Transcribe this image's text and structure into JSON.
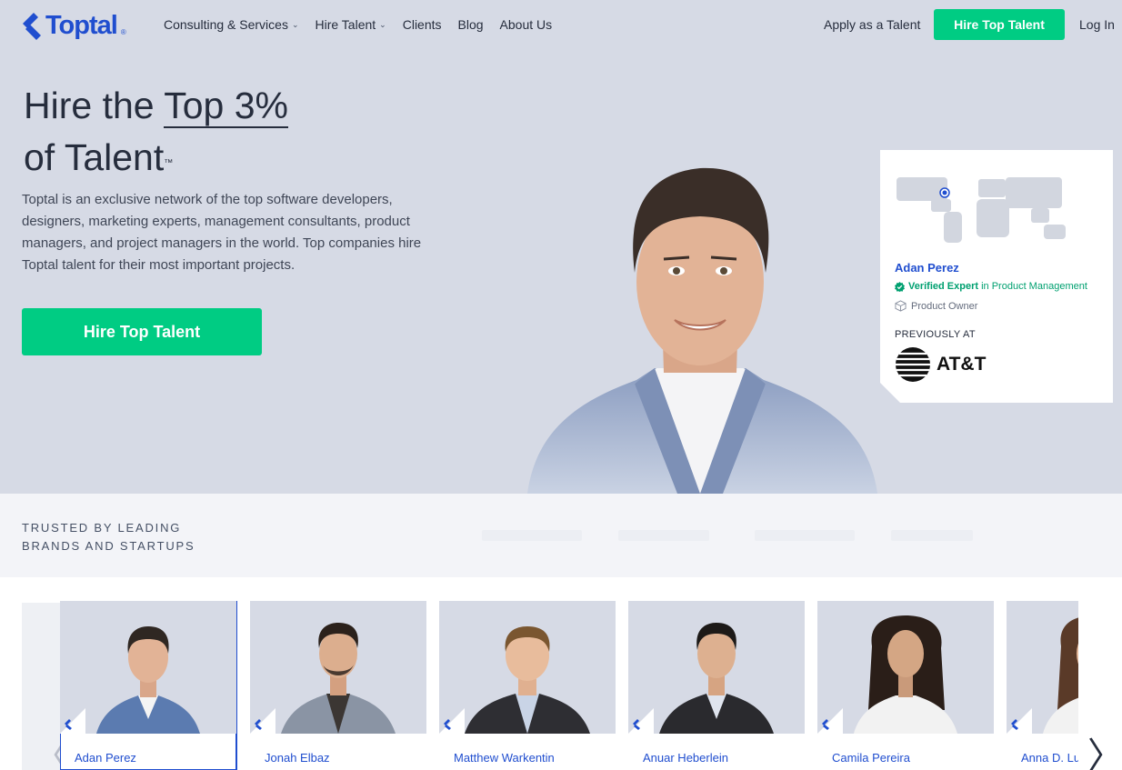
{
  "brand": {
    "name": "Toptal",
    "reg": "®"
  },
  "nav": {
    "items": [
      {
        "label": "Consulting & Services",
        "has_dropdown": true
      },
      {
        "label": "Hire Talent",
        "has_dropdown": true
      },
      {
        "label": "Clients",
        "has_dropdown": false
      },
      {
        "label": "Blog",
        "has_dropdown": false
      },
      {
        "label": "About Us",
        "has_dropdown": false
      }
    ],
    "apply_label": "Apply as a Talent",
    "hire_label": "Hire Top Talent",
    "login_label": "Log In"
  },
  "hero": {
    "title_prefix": "Hire the ",
    "title_highlight": "Top 3%",
    "title_line2": "of Talent",
    "title_tm": "™",
    "description": "Toptal is an exclusive network of the top software developers, designers, marketing experts, management consultants, product managers, and project managers in the world. Top companies hire Toptal talent for their most important projects.",
    "cta_label": "Hire Top Talent"
  },
  "expert_card": {
    "name": "Adan Perez",
    "verified_label": "Verified Expert",
    "verified_field": " in Product Management",
    "role": "Product Owner",
    "previously_label": "PREVIOUSLY AT",
    "company": "AT&T"
  },
  "trusted": {
    "line1": "TRUSTED BY LEADING",
    "line2": "BRANDS AND STARTUPS"
  },
  "carousel": {
    "talents": [
      {
        "name": "Adan Perez",
        "selected": true
      },
      {
        "name": "Jonah Elbaz",
        "selected": false
      },
      {
        "name": "Matthew Warkentin",
        "selected": false
      },
      {
        "name": "Anuar Heberlein",
        "selected": false
      },
      {
        "name": "Camila Pereira",
        "selected": false
      },
      {
        "name": "Anna D. Lu",
        "selected": false
      }
    ],
    "prev_glyph": "〈",
    "next_glyph": "〉"
  },
  "colors": {
    "brand": "#204ecf",
    "cta": "#00cc83",
    "hero_bg": "#d6dae5",
    "verified": "#00a070"
  },
  "icons": [
    "toptal-logo-icon",
    "chevron-down-icon",
    "verified-check-icon",
    "cube-icon",
    "att-globe-icon",
    "world-map-icon"
  ]
}
